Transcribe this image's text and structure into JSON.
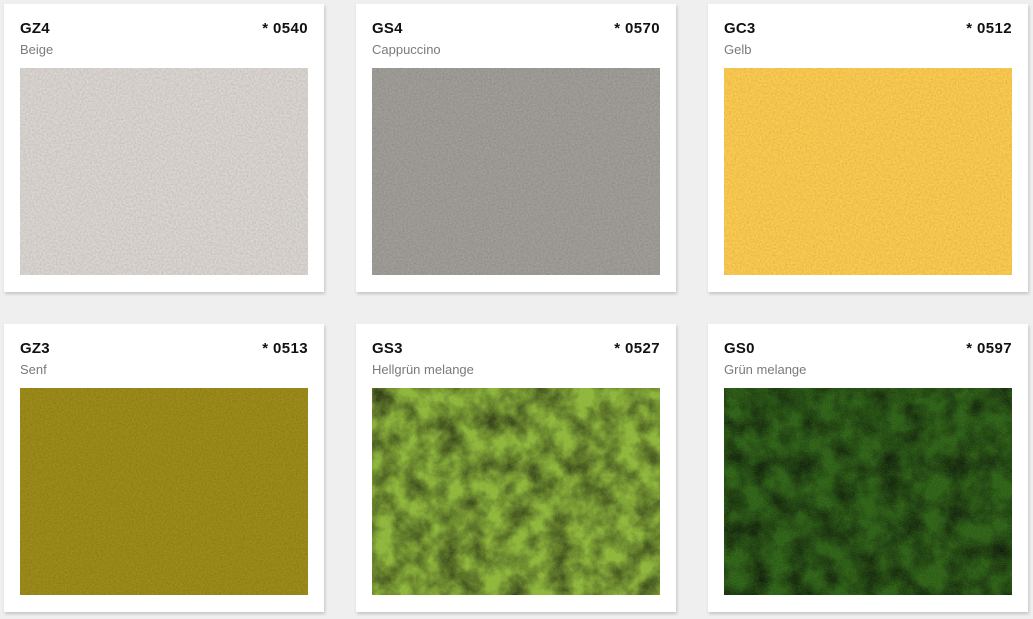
{
  "swatches": [
    {
      "code": "GZ4",
      "number": "* 0540",
      "name": "Beige",
      "color": "#dad5d1",
      "texture": "fine"
    },
    {
      "code": "GS4",
      "number": "* 0570",
      "name": "Cappuccino",
      "color": "#9e9b96",
      "texture": "fine"
    },
    {
      "code": "GC3",
      "number": "* 0512",
      "name": "Gelb",
      "color": "#fdcb4b",
      "texture": "fine"
    },
    {
      "code": "GZ3",
      "number": "* 0513",
      "name": "Senf",
      "color": "#9a8812",
      "texture": "fine"
    },
    {
      "code": "GS3",
      "number": "* 0527",
      "name": "Hellgrün melange",
      "color": "#8cb537",
      "texture": "melange"
    },
    {
      "code": "GS0",
      "number": "* 0597",
      "name": "Grün melange",
      "color": "#2a5e12",
      "texture": "melange"
    }
  ]
}
